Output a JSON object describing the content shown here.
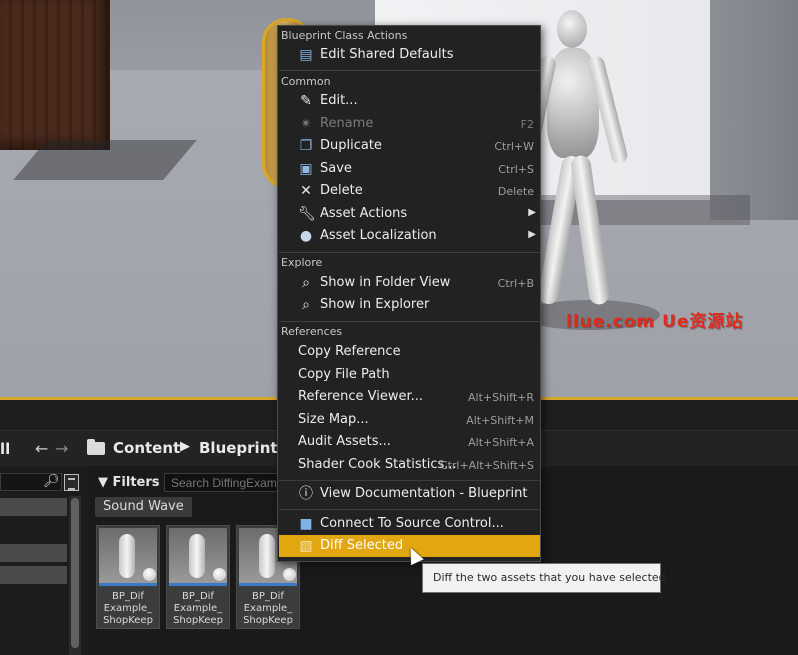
{
  "content_browser": {
    "path_fragment": "ll",
    "crumbs": [
      "Content",
      "Blueprints"
    ],
    "filters_label": "Filters",
    "search_placeholder": "Search DiffingExam",
    "filter_chip": "Sound Wave",
    "tiles": [
      {
        "name": "BP_Dif\nExample_\nShopKeep"
      },
      {
        "name": "BP_Dif\nExample_\nShopKeep"
      },
      {
        "name": "BP_Dif\nExample_\nShopKeep"
      }
    ]
  },
  "context_menu": {
    "sections": {
      "class_actions": "Blueprint Class Actions",
      "common": "Common",
      "explore": "Explore",
      "references": "References"
    },
    "items": {
      "edit_shared_defaults": "Edit Shared Defaults",
      "edit": "Edit...",
      "rename": "Rename",
      "rename_sc": "F2",
      "duplicate": "Duplicate",
      "duplicate_sc": "Ctrl+W",
      "save": "Save",
      "save_sc": "Ctrl+S",
      "delete": "Delete",
      "delete_sc": "Delete",
      "asset_actions": "Asset Actions",
      "asset_localization": "Asset Localization",
      "show_folder": "Show in Folder View",
      "show_folder_sc": "Ctrl+B",
      "show_explorer": "Show in Explorer",
      "copy_reference": "Copy Reference",
      "copy_file_path": "Copy File Path",
      "reference_viewer": "Reference Viewer...",
      "reference_viewer_sc": "Alt+Shift+R",
      "size_map": "Size Map...",
      "size_map_sc": "Alt+Shift+M",
      "audit_assets": "Audit Assets...",
      "audit_assets_sc": "Alt+Shift+A",
      "shader_cook": "Shader Cook Statistics...",
      "shader_cook_sc": "Ctrl+Alt+Shift+S",
      "view_documentation": "View Documentation - Blueprint",
      "connect_source_control": "Connect To Source Control...",
      "diff_selected": "Diff Selected"
    }
  },
  "tooltip": "Diff the two assets that you have selected.",
  "watermark": "llue.com  Ue资源站",
  "colors": {
    "highlight": "#e2a710",
    "selection_outline": "#d8a82b",
    "tile_underline": "#3a79c8",
    "watermark": "#e02a1e"
  }
}
